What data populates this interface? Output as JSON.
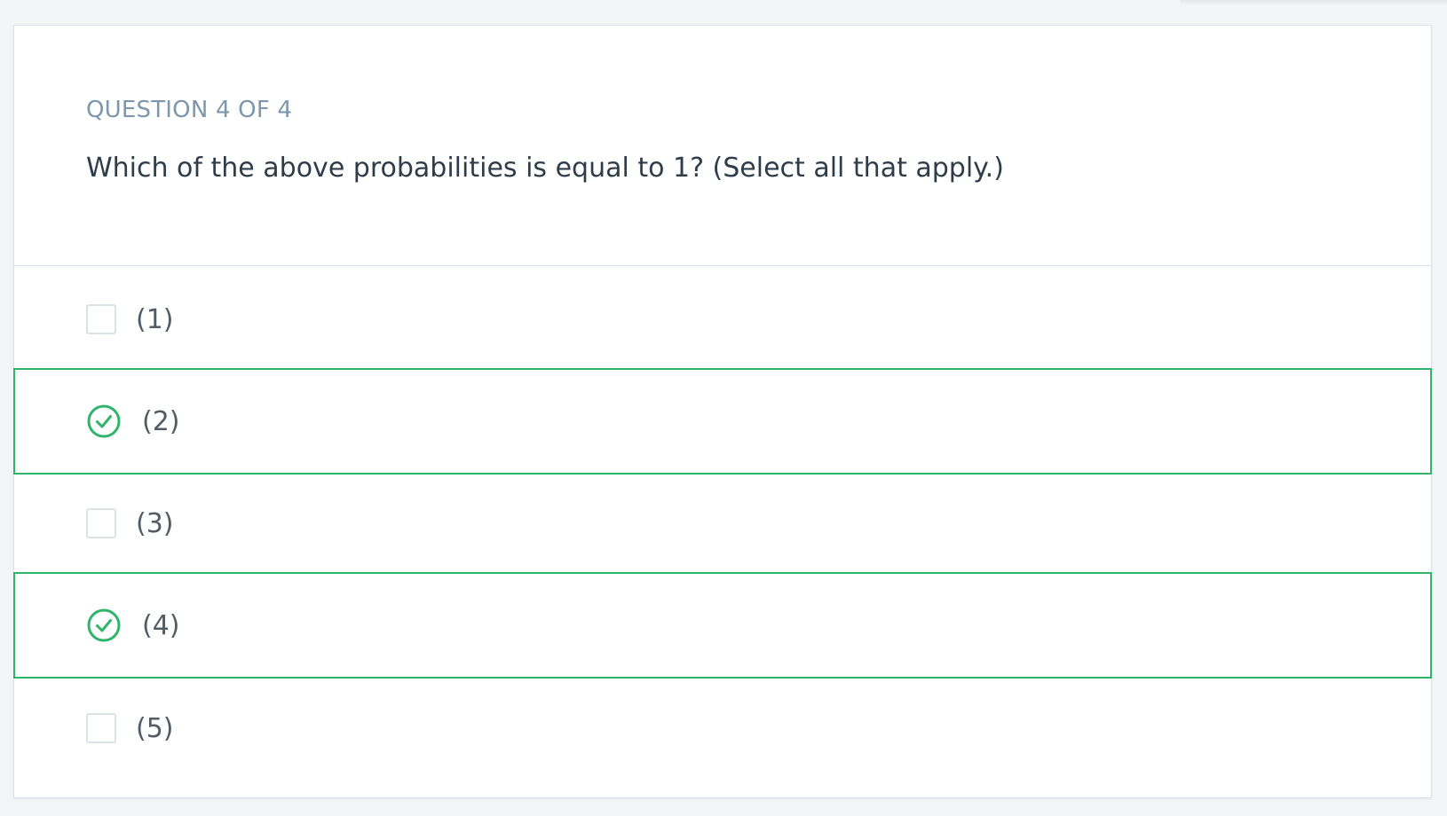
{
  "question": {
    "counter": "QUESTION 4 OF 4",
    "text": "Which of the above probabilities is equal to 1? (Select all that apply.)"
  },
  "options": [
    {
      "label": "(1)",
      "selected": false
    },
    {
      "label": "(2)",
      "selected": true
    },
    {
      "label": "(3)",
      "selected": false
    },
    {
      "label": "(4)",
      "selected": true
    },
    {
      "label": "(5)",
      "selected": false
    }
  ],
  "colors": {
    "accent_green": "#2fb56b",
    "counter_text": "#7d97ad",
    "question_text": "#2e3d49",
    "option_text": "#525c65",
    "border": "#dbe2e8"
  },
  "icons": {
    "selected": "check-circle-icon",
    "unselected": "checkbox-empty"
  }
}
